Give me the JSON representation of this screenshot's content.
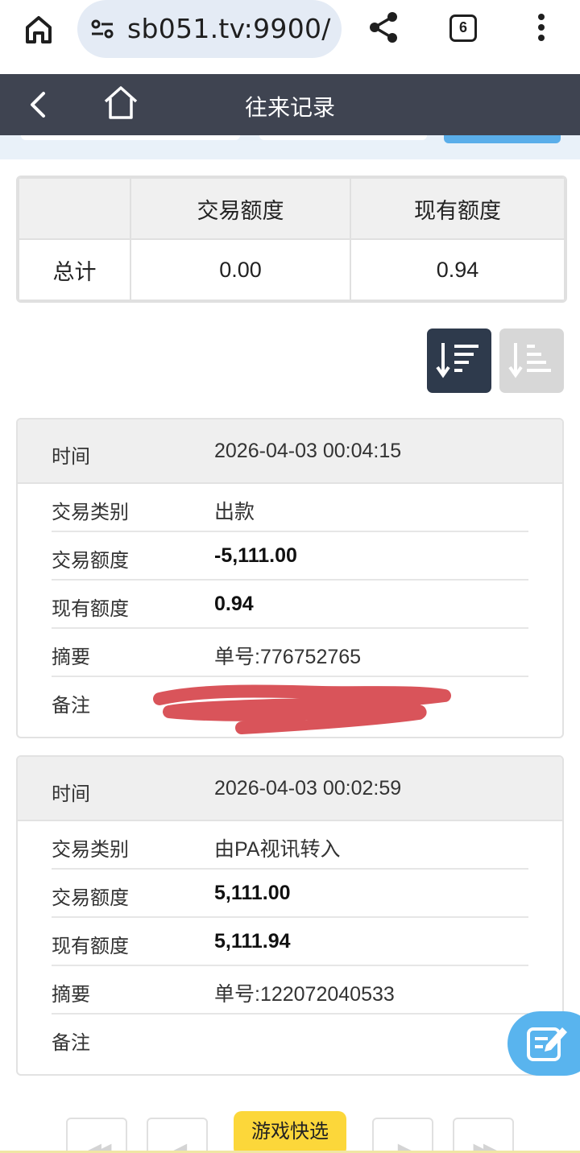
{
  "browser": {
    "url": "sb051.tv:9900/",
    "tab_count": "6"
  },
  "header": {
    "title": "往来记录"
  },
  "summary": {
    "columns": [
      "",
      "交易额度",
      "现有额度"
    ],
    "total_label": "总计",
    "total_transaction": "0.00",
    "total_balance": "0.94"
  },
  "records": [
    {
      "time_label": "时间",
      "time": "2026-04-03 00:04:15",
      "type_label": "交易类别",
      "type": "出款",
      "amount_label": "交易额度",
      "amount": "-5,111.00",
      "balance_label": "现有额度",
      "balance": "0.94",
      "summary_label": "摘要",
      "summary": "单号:776752765",
      "note_label": "备注",
      "note": ""
    },
    {
      "time_label": "时间",
      "time": "2026-04-03 00:02:59",
      "type_label": "交易类别",
      "type": "由PA视讯转入",
      "amount_label": "交易额度",
      "amount": "5,111.00",
      "balance_label": "现有额度",
      "balance": "5,111.94",
      "summary_label": "摘要",
      "summary": "单号:122072040533",
      "note_label": "备注",
      "note": ""
    }
  ],
  "footer": {
    "game_quick_pick": "游戏快选",
    "first_page": "◀◀",
    "prev_page": "◀",
    "next_page": "▶",
    "last_page": "▶▶"
  },
  "colors": {
    "header_bg": "#3f4451",
    "accent_blue": "#59b4ee",
    "sort_active": "#2e3a4c",
    "game_button": "#fcd73a",
    "redaction": "#d9545a"
  }
}
